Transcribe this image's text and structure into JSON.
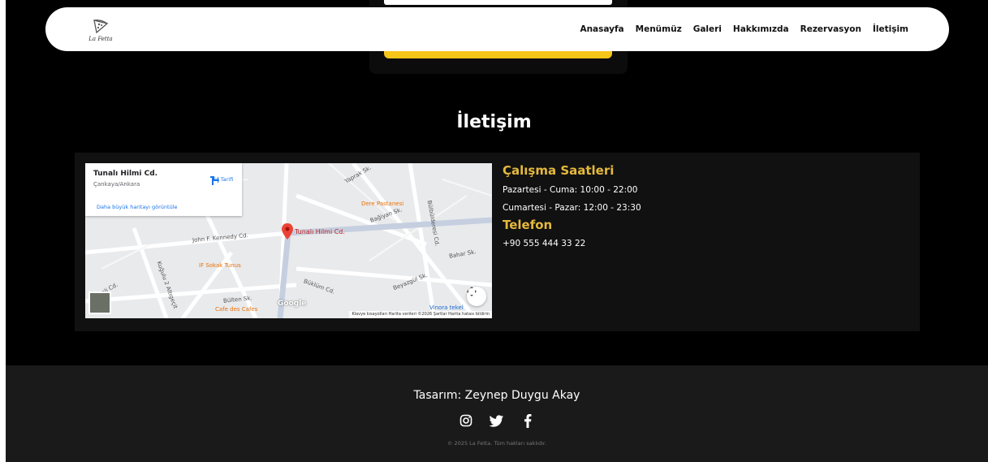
{
  "brand": {
    "logo_text": "La Fetta"
  },
  "nav": {
    "links": [
      "Anasayfa",
      "Menümüz",
      "Galeri",
      "Hakkımızda",
      "Rezervasyon",
      "İletişim"
    ]
  },
  "contact": {
    "title": "İletişim",
    "hours_heading": "Çalışma Saatleri",
    "weekday_hours": "Pazartesi - Cuma: 10:00 - 22:00",
    "weekend_hours": "Cumartesi - Pazar: 12:00 - 23:30",
    "phone_heading": "Telefon",
    "phone": "+90 555 444 33 22"
  },
  "map": {
    "place_name": "Tunalı Hilmi Cd.",
    "place_sub": "Çankaya/Ankara",
    "bigger_map_link": "Daha büyük haritayı görüntüle",
    "directions_label": "Yol Tarifi",
    "pin_label": "Tunalı Hilmi Cd.",
    "google": "Google",
    "attribution": "Klavye kısayolları   Harita verileri ©2026   Şartlar   Harita hatası bildirin",
    "labels": {
      "kennedy": "John F. Kennedy Cd.",
      "dere": "Dere Pastanesi",
      "bagiyan": "Bağiyan Sk.",
      "bahar": "Bahar Sk.",
      "sokak": "IF Sokak Tunus",
      "bulten": "Bülten Sk.",
      "cafe": "Cafe des Cafes",
      "vinera": "Vinora tekel",
      "buklum": "Büklüm Cd.",
      "beysargul": "Beyazgül Sk.",
      "bulbulderesi": "Bülbülderesi Cd.",
      "yaprak": "Yaprak Sk.",
      "kugulu": "Kuğulu 2 Altıgeçit",
      "dali": "Dali Cd."
    }
  },
  "footer": {
    "credit": "Tasarım: Zeynep Duygu Akay",
    "copyright": "© 2025 La Fetta. Tüm hakları saklıdır.",
    "social": [
      "instagram-icon",
      "twitter-icon",
      "facebook-icon"
    ]
  },
  "colors": {
    "accent": "#e5b93d",
    "button_yellow": "#f5c518",
    "background": "#000000",
    "panel": "#111111",
    "footer": "#1a1a1a"
  }
}
